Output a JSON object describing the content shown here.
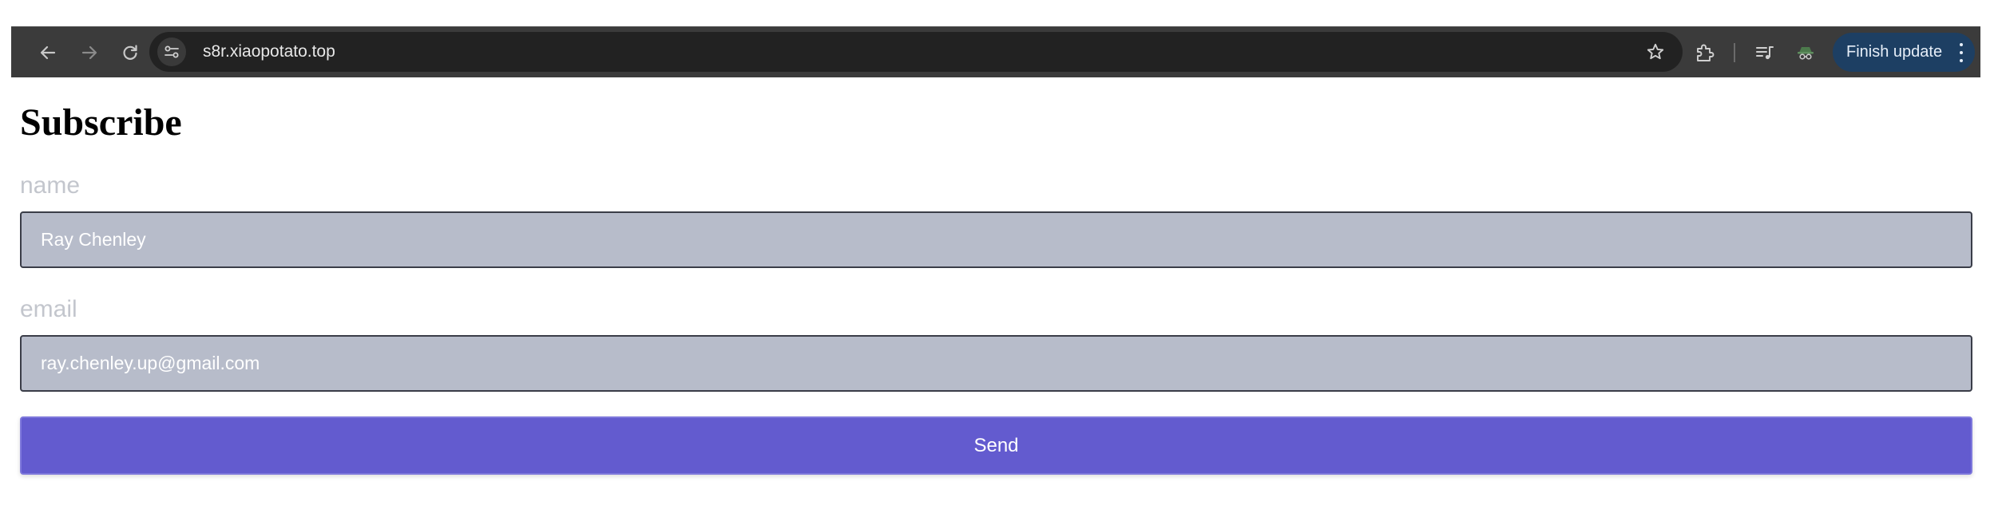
{
  "browser": {
    "back_icon": "arrow-left-icon",
    "forward_icon": "arrow-right-icon",
    "reload_icon": "reload-icon",
    "site_info_icon": "tune-icon",
    "url": "s8r.xiaopotato.top",
    "bookmark_icon": "star-icon",
    "extensions_icon": "puzzle-icon",
    "media_icon": "queue-music-icon",
    "profile_icon": "incognito-avatar-icon",
    "update_button_label": "Finish update",
    "update_menu_icon": "more-vertical-icon",
    "colors": {
      "toolbar": "#3b3b3b",
      "omnibox": "#222222",
      "update_button": "#1d3f63"
    }
  },
  "page": {
    "title": "Subscribe",
    "name_label": "name",
    "name_value": "Ray Chenley",
    "email_label": "email",
    "email_value": "ray.chenley.up@gmail.com",
    "send_label": "Send",
    "colors": {
      "input_bg": "#b7bcca",
      "label": "#c3c6cd",
      "send_button": "#635bcf"
    }
  }
}
